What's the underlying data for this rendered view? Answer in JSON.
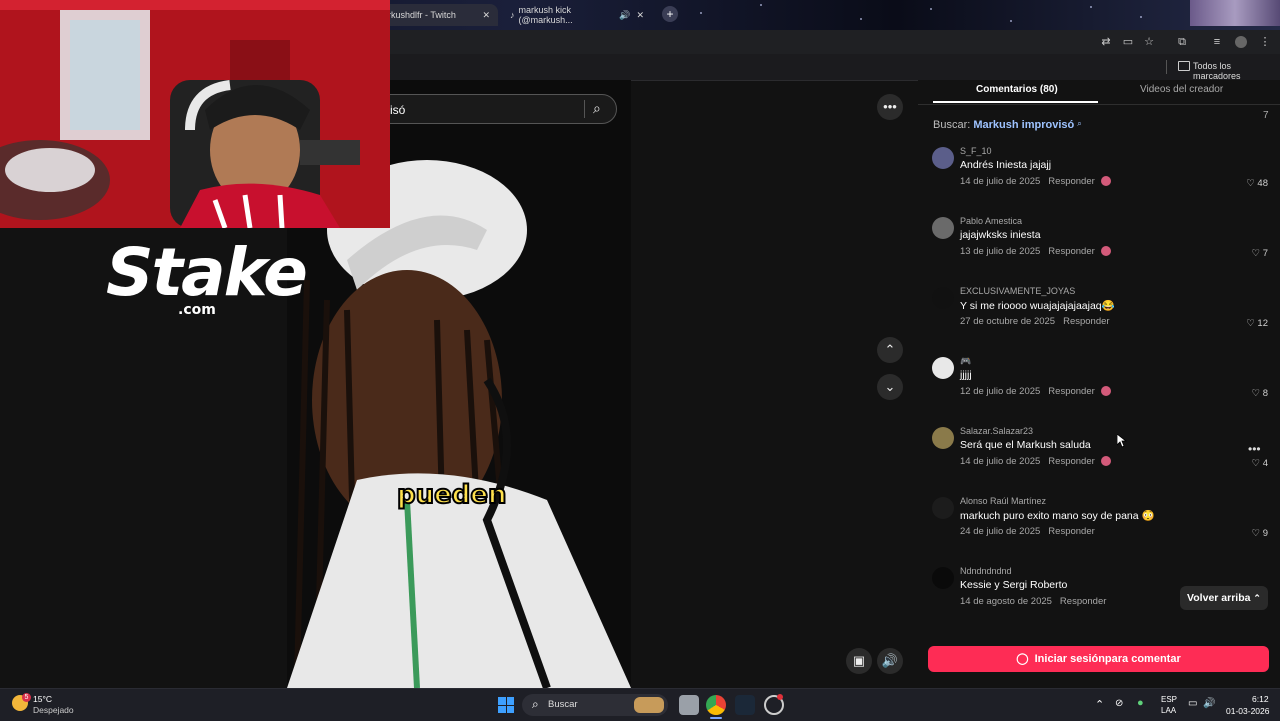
{
  "browser": {
    "tabs": [
      {
        "label": "rkushdlfr - Twitch"
      },
      {
        "label": "markush kick (@markush..."
      }
    ],
    "bookmarks_label": "Todos los marcadores"
  },
  "video": {
    "search_value": "isó",
    "caption": "pueden"
  },
  "stake": {
    "brand": "Stake",
    "domain": ".com"
  },
  "panel": {
    "tabs": [
      {
        "label": "Comentarios (80)"
      },
      {
        "label": "Videos del creador"
      }
    ],
    "counter": "7",
    "search_prefix": "Buscar:",
    "search_term": "Markush improvisó",
    "comments": [
      {
        "user": "S_F_10",
        "text": "Andrés Iniesta jajajj",
        "date": "14 de julio de 2025",
        "reply": "Responder",
        "likes": "48",
        "avatar_color": "#5b5e8a"
      },
      {
        "user": "Pablo Amestica",
        "text": "jajajwksks iniesta",
        "date": "13 de julio de 2025",
        "reply": "Responder",
        "likes": "7",
        "avatar_color": "#6a6a6a"
      },
      {
        "user": "EXCLUSIVAMENTE_JOYAS",
        "text": "Y si me rioooo wuajajajajaajaq😂",
        "date": "27 de octubre de 2025",
        "reply": "Responder",
        "likes": "12",
        "avatar_color": "#111111"
      },
      {
        "user": "🎮",
        "text": "jjjjj",
        "date": "12 de julio de 2025",
        "reply": "Responder",
        "likes": "8",
        "avatar_color": "#e8e8e8"
      },
      {
        "user": "Salazar.Salazar23",
        "text": "Será que el Markush saluda",
        "date": "14 de julio de 2025",
        "reply": "Responder",
        "likes": "4",
        "avatar_color": "#8a7a4a"
      },
      {
        "user": "Alonso Raúl Martínez",
        "text": "markuch puro exito mano soy de pana 😳",
        "date": "24 de julio de 2025",
        "reply": "Responder",
        "likes": "9",
        "avatar_color": "#1c1c1c"
      },
      {
        "user": "Ndndndndnd",
        "text": "Kessie y Sergi Roberto",
        "date": "14 de agosto de 2025",
        "reply": "Responder",
        "likes": "",
        "avatar_color": "#0a0a0a"
      }
    ],
    "back_to_top": "Volver arriba",
    "login_cta": "Iniciar sesiónpara comentar"
  },
  "taskbar": {
    "weather_temp": "15°C",
    "weather_desc": "Despejado",
    "weather_badge": "5",
    "search_label": "Buscar",
    "lang_top": "ESP",
    "lang_bottom": "LAA",
    "time": "6:12",
    "date": "01-03-2026"
  },
  "colors": {
    "accent": "#fe2c55",
    "link": "#9ec3ff"
  }
}
